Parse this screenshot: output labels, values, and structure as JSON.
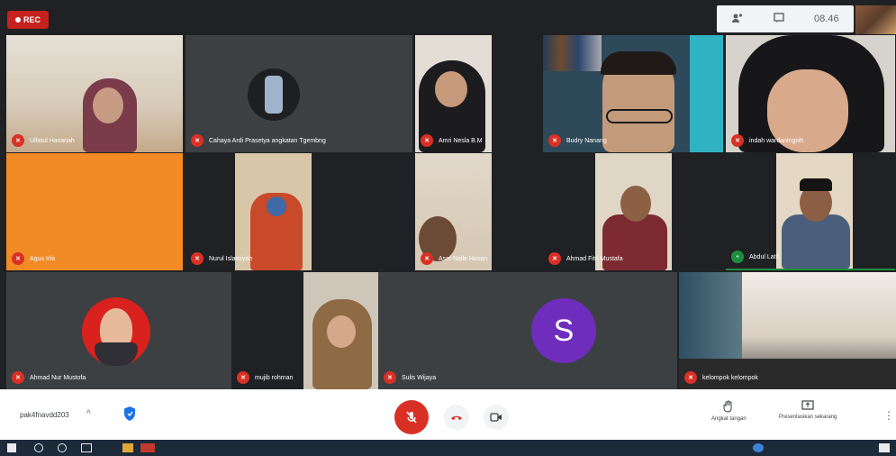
{
  "top": {
    "rec_label": "REC",
    "time_label": "08.46"
  },
  "tiles": [
    {
      "name": "Ulfatul Hasanah"
    },
    {
      "name": "Cahaya Ardi Prasetya angkatan Tgembng"
    },
    {
      "name": "Amri Nesla B.M"
    },
    {
      "name": "Budry Nanang"
    },
    {
      "name": "indah wardaningsih"
    },
    {
      "name": "Agus Irfa"
    },
    {
      "name": "Nurul Islamiyah"
    },
    {
      "name": "Asef Nalle Hasan"
    },
    {
      "name": "Ahmad Fitri Mustafa"
    },
    {
      "name": "Abdul Latif"
    },
    {
      "name": "Ahmad Nur Mustofa"
    },
    {
      "name": "mujib rohman"
    },
    {
      "name": "Sulis Wijaya",
      "initial": "S"
    },
    {
      "name": "kelompok kelompok"
    }
  ],
  "controls": {
    "meeting_code": "pak4fnavdd203",
    "raise_hand_label": "Angkat tangan",
    "present_label": "Presentasikan sekarang"
  },
  "colors": {
    "accent_red": "#d93025",
    "dark_bg": "#202124",
    "tile_bg": "#3c4043",
    "orange_tile": "#f28b24",
    "avatar_purple": "#6f2dbd"
  }
}
